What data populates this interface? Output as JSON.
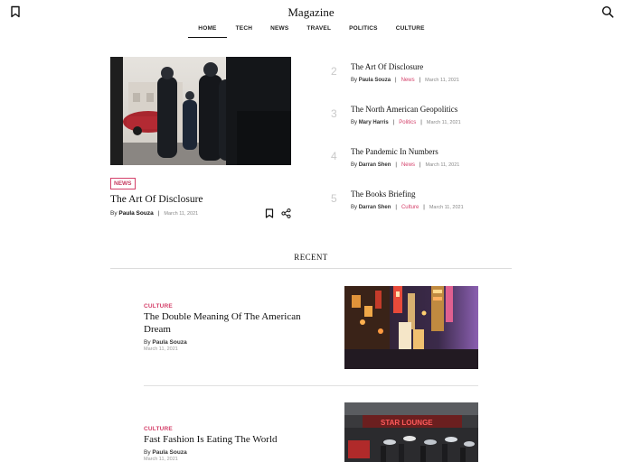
{
  "header": {
    "brand": "Magazine",
    "bookmark_icon": "bookmark-icon",
    "search_icon": "search-icon"
  },
  "nav": {
    "items": [
      {
        "label": "HOME",
        "active": true
      },
      {
        "label": "TECH",
        "active": false
      },
      {
        "label": "NEWS",
        "active": false
      },
      {
        "label": "TRAVEL",
        "active": false
      },
      {
        "label": "POLITICS",
        "active": false
      },
      {
        "label": "CULTURE",
        "active": false
      }
    ]
  },
  "featured": {
    "tag": "NEWS",
    "title": "The Art Of Disclosure",
    "by": "By",
    "author": "Paula Souza",
    "separator": "|",
    "date": "March 11, 2021"
  },
  "side_articles": [
    {
      "num": "2",
      "title": "The Art Of Disclosure",
      "by": "By",
      "author": "Paula Souza",
      "category": "News",
      "date": "March 11, 2021"
    },
    {
      "num": "3",
      "title": "The North American Geopolitics",
      "by": "By",
      "author": "Mary Harris",
      "category": "Politics",
      "date": "March 11, 2021"
    },
    {
      "num": "4",
      "title": "The Pandemic In Numbers",
      "by": "By",
      "author": "Darran Shen",
      "category": "News",
      "date": "March 11, 2021"
    },
    {
      "num": "5",
      "title": "The Books Briefing",
      "by": "By",
      "author": "Darran Shen",
      "category": "Culture",
      "date": "March 11, 2021"
    }
  ],
  "recent": {
    "heading": "RECENT",
    "items": [
      {
        "category": "CULTURE",
        "title": "The Double Meaning Of The American Dream",
        "by": "By",
        "author": "Paula Souza",
        "date": "March 11, 2021"
      },
      {
        "category": "CULTURE",
        "title": "Fast Fashion Is Eating The World",
        "by": "By",
        "author": "Paula Souza",
        "date": "March 11, 2021"
      }
    ]
  },
  "image_text": {
    "sign": "STAR LOUNGE"
  },
  "colors": {
    "accent": "#d4406a",
    "text": "#111111",
    "muted": "#888888",
    "divider": "#dcdcdc"
  }
}
